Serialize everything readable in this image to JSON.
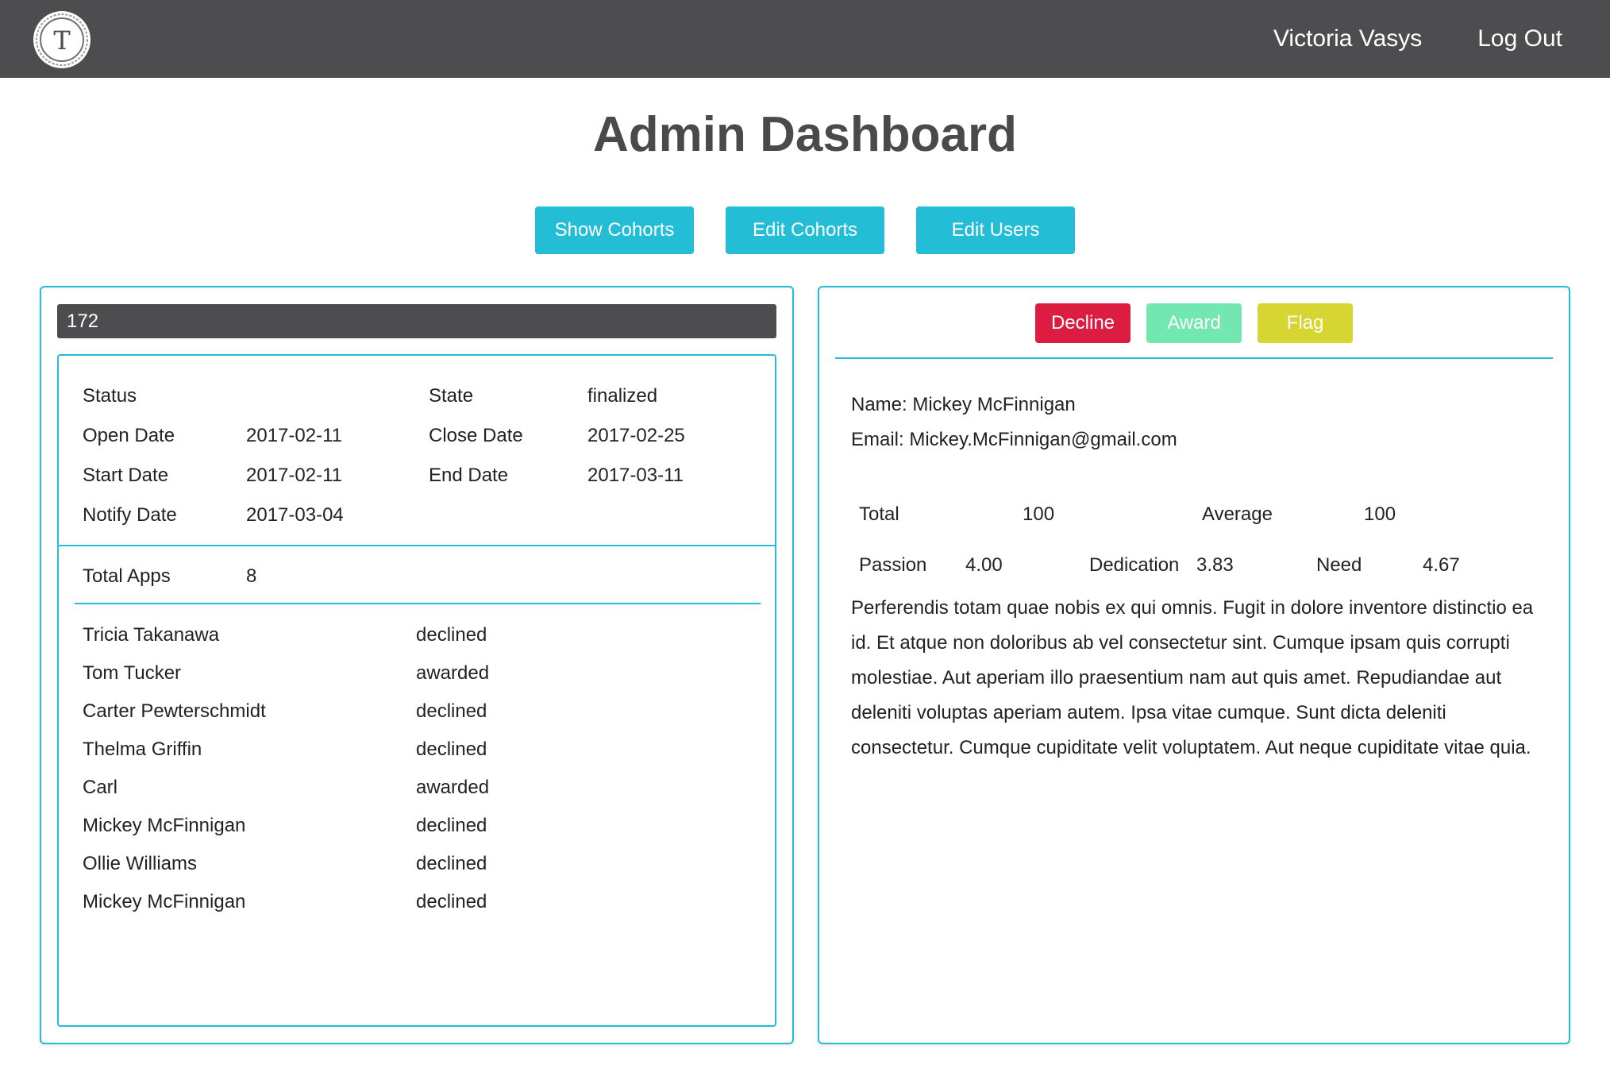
{
  "header": {
    "logo_letter": "T",
    "user_name": "Victoria Vasys",
    "logout_label": "Log Out"
  },
  "page": {
    "title": "Admin Dashboard"
  },
  "toolbar": {
    "show_cohorts": "Show Cohorts",
    "edit_cohorts": "Edit Cohorts",
    "edit_users": "Edit Users"
  },
  "cohort": {
    "id": "172",
    "labels": {
      "status": "Status",
      "state": "State",
      "open_date": "Open Date",
      "close_date": "Close Date",
      "start_date": "Start Date",
      "end_date": "End Date",
      "notify_date": "Notify Date",
      "total_apps": "Total Apps"
    },
    "values": {
      "status": "",
      "state": "finalized",
      "open_date": "2017-02-11",
      "close_date": "2017-02-25",
      "start_date": "2017-02-11",
      "end_date": "2017-03-11",
      "notify_date": "2017-03-04",
      "total_apps": "8"
    },
    "applications": [
      {
        "name": "Tricia Takanawa",
        "status": "declined"
      },
      {
        "name": "Tom Tucker",
        "status": "awarded"
      },
      {
        "name": "Carter Pewterschmidt",
        "status": "declined"
      },
      {
        "name": "Thelma Griffin",
        "status": "declined"
      },
      {
        "name": "Carl",
        "status": "awarded"
      },
      {
        "name": "Mickey McFinnigan",
        "status": "declined"
      },
      {
        "name": "Ollie Williams",
        "status": "declined"
      },
      {
        "name": "Mickey McFinnigan",
        "status": "declined"
      }
    ]
  },
  "actions": {
    "decline": "Decline",
    "award": "Award",
    "flag": "Flag"
  },
  "applicant": {
    "name_line": "Name: Mickey McFinnigan",
    "email_line": "Email: Mickey.McFinnigan@gmail.com",
    "labels": {
      "total": "Total",
      "average": "Average",
      "passion": "Passion",
      "dedication": "Dedication",
      "need": "Need"
    },
    "values": {
      "total": "100",
      "average": "100",
      "passion": "4.00",
      "dedication": "3.83",
      "need": "4.67"
    },
    "essay": "Perferendis totam quae nobis ex qui omnis. Fugit in dolore inventore distinctio ea id. Et atque non doloribus ab vel consectetur sint. Cumque ipsam quis corrupti molestiae. Aut aperiam illo praesentium nam aut quis amet. Repudiandae aut deleniti voluptas aperiam autem. Ipsa vitae cumque. Sunt dicta deleniti consectetur. Cumque cupiditate velit voluptatem. Aut neque cupiditate vitae quia."
  },
  "colors": {
    "topbar": "#4d4d4f",
    "accent": "#23bdd6",
    "decline": "#dd1c42",
    "award": "#72e8b0",
    "flag": "#d6d532"
  }
}
